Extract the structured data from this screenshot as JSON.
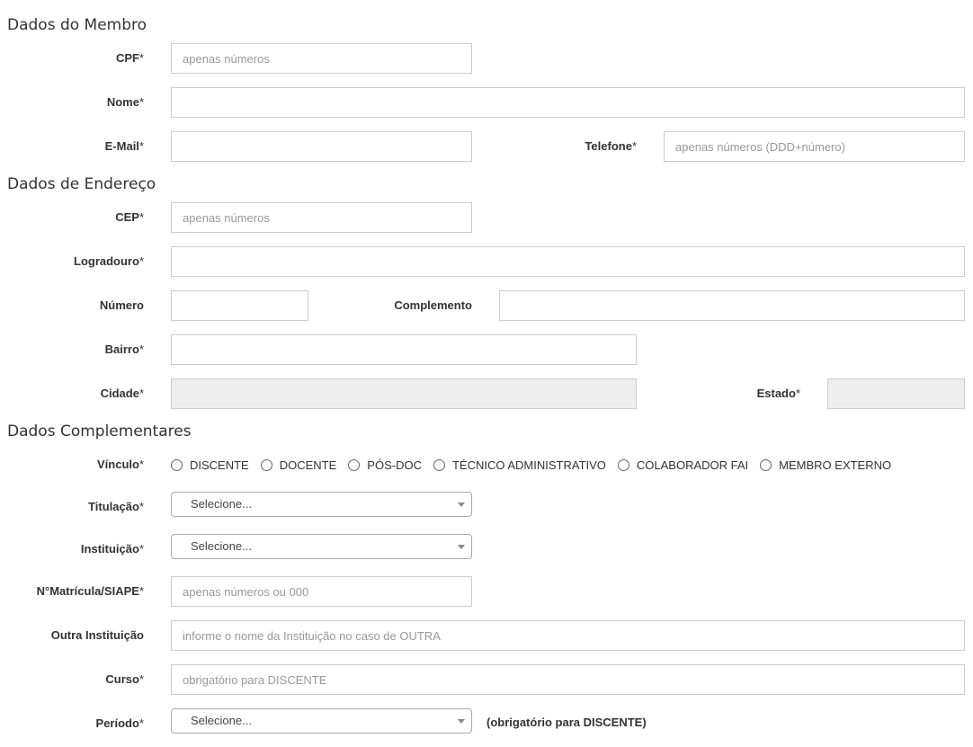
{
  "sections": {
    "membro": "Dados do Membro",
    "endereco": "Dados de Endereço",
    "complementares": "Dados Complementares"
  },
  "required_mark": "*",
  "membro": {
    "cpf": {
      "label": "CPF",
      "placeholder": "apenas números",
      "value": ""
    },
    "nome": {
      "label": "Nome",
      "placeholder": "",
      "value": ""
    },
    "email": {
      "label": "E-Mail",
      "placeholder": "",
      "value": ""
    },
    "telefone": {
      "label": "Telefone",
      "placeholder": "apenas números (DDD+número)",
      "value": ""
    }
  },
  "endereco": {
    "cep": {
      "label": "CEP",
      "placeholder": "apenas números",
      "value": ""
    },
    "logradouro": {
      "label": "Logradouro",
      "placeholder": "",
      "value": ""
    },
    "numero": {
      "label": "Número",
      "placeholder": "",
      "value": ""
    },
    "complemento": {
      "label": "Complemento",
      "placeholder": "",
      "value": ""
    },
    "bairro": {
      "label": "Bairro",
      "placeholder": "",
      "value": ""
    },
    "cidade": {
      "label": "Cidade",
      "value": ""
    },
    "estado": {
      "label": "Estado",
      "value": ""
    }
  },
  "complementares": {
    "vinculo": {
      "label": "Vínculo",
      "options": [
        "DISCENTE",
        "DOCENTE",
        "PÓS-DOC",
        "TÉCNICO ADMINISTRATIVO",
        "COLABORADOR FAI",
        "MEMBRO EXTERNO"
      ]
    },
    "titulacao": {
      "label": "Titulação",
      "selected": "Selecione..."
    },
    "instituicao": {
      "label": "Instituição",
      "selected": "Selecione..."
    },
    "matricula": {
      "label": "N°Matrícula/SIAPE",
      "placeholder": "apenas números ou 000",
      "value": ""
    },
    "outra_instituicao": {
      "label": "Outra Instituição",
      "placeholder": "informe o nome da Instituição no caso de OUTRA",
      "value": ""
    },
    "curso": {
      "label": "Curso",
      "placeholder": "obrigatório para DISCENTE",
      "value": ""
    },
    "periodo": {
      "label": "Período",
      "selected": "Selecione...",
      "note": "(obrigatório para DISCENTE)"
    }
  }
}
